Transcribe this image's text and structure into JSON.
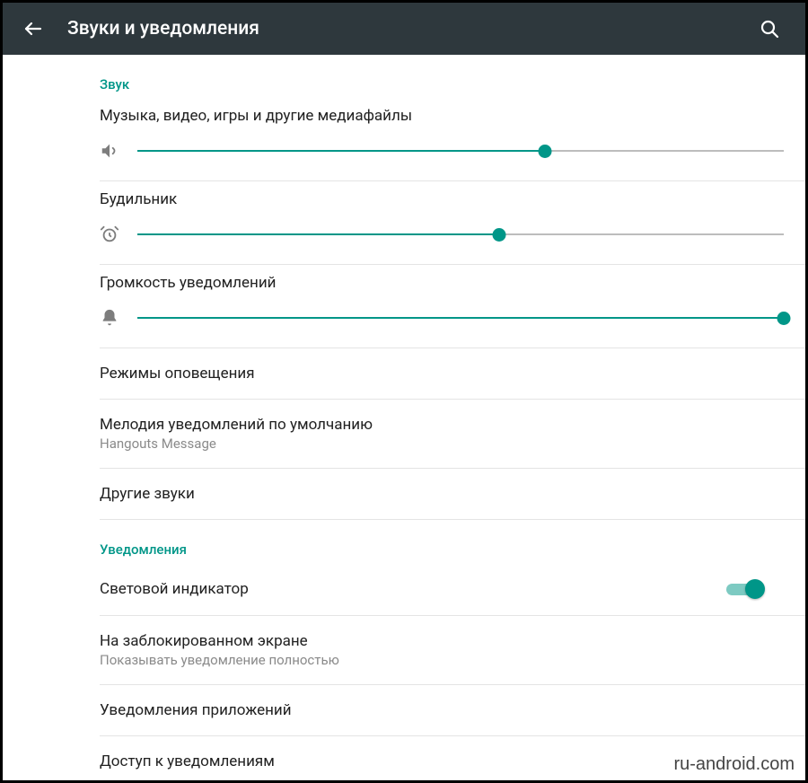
{
  "colors": {
    "accent": "#009688"
  },
  "appbar": {
    "title": "Звуки и уведомления"
  },
  "sections": {
    "sound": {
      "header": "Звук",
      "media": {
        "label": "Музыка, видео, игры и другие медиафайлы",
        "value": 63
      },
      "alarm": {
        "label": "Будильник",
        "value": 56
      },
      "notification_volume": {
        "label": "Громкость уведомлений",
        "value": 100
      },
      "alert_modes": {
        "label": "Режимы оповещения"
      },
      "default_ringtone": {
        "label": "Мелодия уведомлений по умолчанию",
        "value": "Hangouts Message"
      },
      "other_sounds": {
        "label": "Другие звуки"
      }
    },
    "notifications": {
      "header": "Уведомления",
      "light_indicator": {
        "label": "Световой индикатор",
        "enabled": true
      },
      "lock_screen": {
        "label": "На заблокированном экране",
        "value": "Показывать уведомление полностью"
      },
      "app_notifications": {
        "label": "Уведомления приложений"
      },
      "notification_access": {
        "label": "Доступ к уведомлениям"
      }
    }
  },
  "watermark": "ru-android.com"
}
